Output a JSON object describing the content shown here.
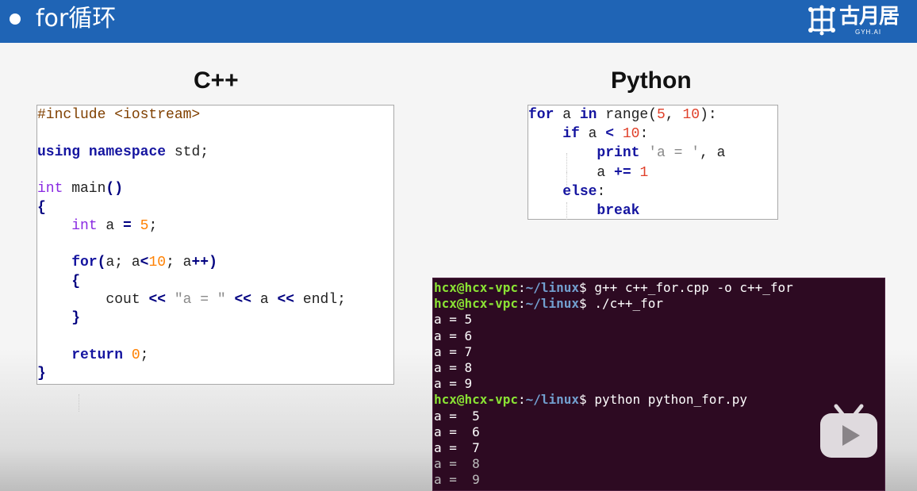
{
  "header": {
    "title": "for循环",
    "logo_text": "古月居",
    "logo_sub": "GYH.AI"
  },
  "cpp": {
    "heading": "C++",
    "code": [
      [
        {
          "t": "#include <iostream>",
          "c": "c-pre"
        }
      ],
      [],
      [
        {
          "t": "using",
          "c": "c-kw"
        },
        {
          "t": " "
        },
        {
          "t": "namespace",
          "c": "c-kw"
        },
        {
          "t": " std;"
        }
      ],
      [],
      [
        {
          "t": "int",
          "c": "c-type"
        },
        {
          "t": " main"
        },
        {
          "t": "()",
          "c": "c-op"
        }
      ],
      [
        {
          "t": "{",
          "c": "c-op"
        }
      ],
      [
        {
          "t": "    "
        },
        {
          "t": "int",
          "c": "c-type"
        },
        {
          "t": " a "
        },
        {
          "t": "=",
          "c": "c-op"
        },
        {
          "t": " "
        },
        {
          "t": "5",
          "c": "c-num"
        },
        {
          "t": ";"
        }
      ],
      [],
      [
        {
          "t": "    "
        },
        {
          "t": "for",
          "c": "c-kw"
        },
        {
          "t": "(",
          "c": "c-op"
        },
        {
          "t": "a; a"
        },
        {
          "t": "<",
          "c": "c-op"
        },
        {
          "t": "10",
          "c": "c-num"
        },
        {
          "t": "; a"
        },
        {
          "t": "++)",
          "c": "c-op"
        }
      ],
      [
        {
          "t": "    "
        },
        {
          "t": "{",
          "c": "c-op"
        }
      ],
      [
        {
          "t": "        cout "
        },
        {
          "t": "<<",
          "c": "c-op"
        },
        {
          "t": " "
        },
        {
          "t": "\"a = \"",
          "c": "c-str"
        },
        {
          "t": " "
        },
        {
          "t": "<<",
          "c": "c-op"
        },
        {
          "t": " a "
        },
        {
          "t": "<<",
          "c": "c-op"
        },
        {
          "t": " endl;"
        }
      ],
      [
        {
          "t": "    "
        },
        {
          "t": "}",
          "c": "c-op"
        }
      ],
      [],
      [
        {
          "t": "    "
        },
        {
          "t": "return",
          "c": "c-kw"
        },
        {
          "t": " "
        },
        {
          "t": "0",
          "c": "c-num"
        },
        {
          "t": ";"
        }
      ],
      [
        {
          "t": "}",
          "c": "c-op"
        }
      ]
    ]
  },
  "python": {
    "heading": "Python",
    "code": [
      [
        {
          "t": "for",
          "c": "p-kw"
        },
        {
          "t": " a "
        },
        {
          "t": "in",
          "c": "p-kw"
        },
        {
          "t": " range("
        },
        {
          "t": "5",
          "c": "p-num"
        },
        {
          "t": ", "
        },
        {
          "t": "10",
          "c": "p-num"
        },
        {
          "t": "):"
        }
      ],
      [
        {
          "t": "    "
        },
        {
          "t": "if",
          "c": "p-kw"
        },
        {
          "t": " a "
        },
        {
          "t": "<",
          "c": "p-kw"
        },
        {
          "t": " "
        },
        {
          "t": "10",
          "c": "p-num"
        },
        {
          "t": ":"
        }
      ],
      [
        {
          "t": "        "
        },
        {
          "t": "print",
          "c": "p-kw"
        },
        {
          "t": " "
        },
        {
          "t": "'a = '",
          "c": "p-str"
        },
        {
          "t": ", a"
        }
      ],
      [
        {
          "t": "        a "
        },
        {
          "t": "+=",
          "c": "p-kw"
        },
        {
          "t": " "
        },
        {
          "t": "1",
          "c": "p-num"
        }
      ],
      [
        {
          "t": "    "
        },
        {
          "t": "else",
          "c": "p-kw"
        },
        {
          "t": ":"
        }
      ],
      [
        {
          "t": "        "
        },
        {
          "t": "break",
          "c": "p-kw"
        }
      ]
    ]
  },
  "terminal": {
    "lines": [
      {
        "user": "hcx@hcx-vpc",
        "path": "~/linux",
        "cmd": "$ g++ c++_for.cpp -o c++_for"
      },
      {
        "user": "hcx@hcx-vpc",
        "path": "~/linux",
        "cmd": "$ ./c++_for"
      },
      {
        "out": "a = 5"
      },
      {
        "out": "a = 6"
      },
      {
        "out": "a = 7"
      },
      {
        "out": "a = 8"
      },
      {
        "out": "a = 9"
      },
      {
        "user": "hcx@hcx-vpc",
        "path": "~/linux",
        "cmd": "$ python python_for.py"
      },
      {
        "out": "a =  5"
      },
      {
        "out": "a =  6"
      },
      {
        "out": "a =  7"
      },
      {
        "out": "a =  8"
      },
      {
        "out": "a =  9"
      }
    ]
  },
  "icons": {
    "play": "bilibili-play-icon",
    "bullet": "bullet-icon",
    "logo": "gyh-logo-icon"
  }
}
